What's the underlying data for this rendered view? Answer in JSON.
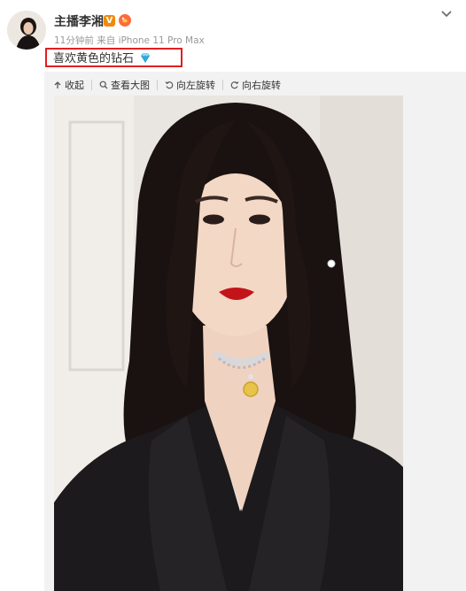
{
  "post": {
    "author": "主播李湘",
    "verified_badge": "V",
    "time": "11分钟前",
    "source_prefix": "来自",
    "source": "iPhone 11 Pro Max",
    "text": "喜欢黄色的钻石"
  },
  "toolbar": {
    "collapse": "收起",
    "view_large": "查看大图",
    "rotate_left": "向左旋转",
    "rotate_right": "向右旋转"
  },
  "colors": {
    "highlight_border": "#e02020",
    "verified_badge": "#f08a0c",
    "meta_text": "#999999"
  },
  "icons": [
    "chevron-down-icon",
    "diamond-icon",
    "collapse-icon",
    "search-icon",
    "rotate-left-icon",
    "rotate-right-icon",
    "fan-badge-icon"
  ]
}
